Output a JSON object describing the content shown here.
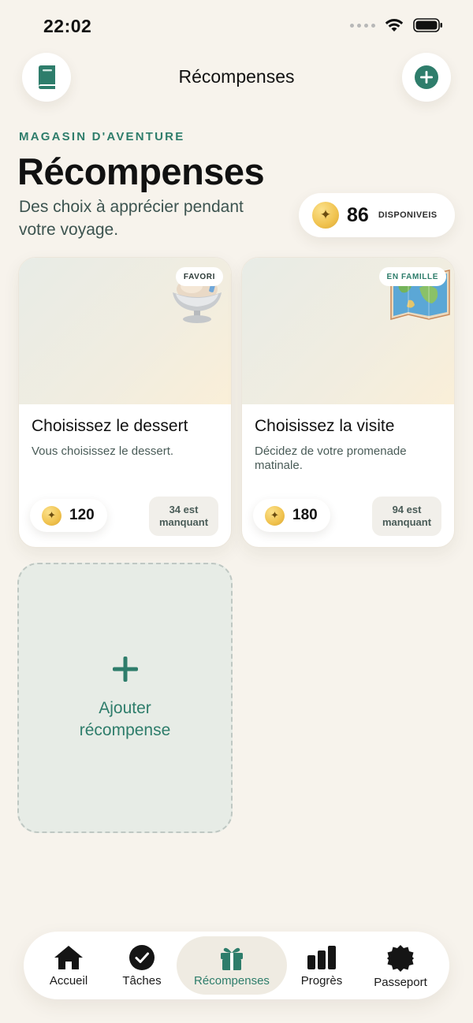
{
  "status": {
    "time": "22:02"
  },
  "header": {
    "title": "Récompenses",
    "left_icon": "book-icon",
    "right_icon": "add-circle-icon"
  },
  "hero": {
    "eyebrow": "MAGASIN D'AVENTURE",
    "title": "Récompenses",
    "subtitle": "Des choix à apprécier pendant votre voyage.",
    "balance_value": "86",
    "balance_label": "DISPONIVEIS"
  },
  "rewards": [
    {
      "tag": "FAVORI",
      "name": "Choisissez le dessert",
      "desc": "Vous choisissez le dessert.",
      "cost": "120",
      "missing_line1": "34 est",
      "missing_line2": "manquant",
      "art_icon": "dessert-bowl-icon"
    },
    {
      "tag": "EN FAMILLE",
      "name": "Choisissez la visite",
      "desc": "Décidez de votre promenade matinale.",
      "cost": "180",
      "missing_line1": "94 est",
      "missing_line2": "manquant",
      "art_icon": "map-icon"
    }
  ],
  "add_tile": {
    "line1": "Ajouter",
    "line2": "récompense"
  },
  "tabs": [
    {
      "label": "Accueil",
      "icon": "home-icon"
    },
    {
      "label": "Tâches",
      "icon": "check-circle-icon"
    },
    {
      "label": "Récompenses",
      "icon": "gift-icon",
      "active": true
    },
    {
      "label": "Progrès",
      "icon": "bar-chart-icon"
    },
    {
      "label": "Passeport",
      "icon": "badge-icon"
    }
  ],
  "colors": {
    "accent": "#2E7D6B",
    "background": "#F7F3EC",
    "coin": "#F0C24E"
  }
}
